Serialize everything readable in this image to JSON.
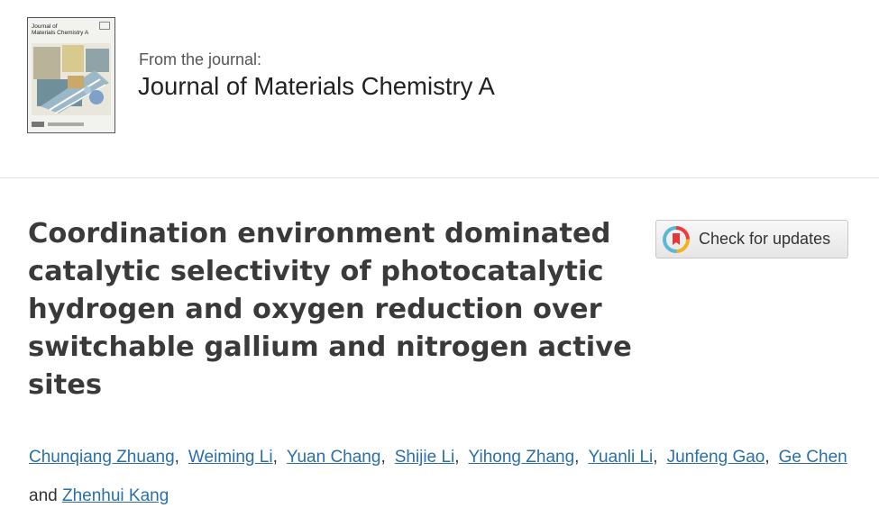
{
  "journal": {
    "cover_title": "Journal of\nMaterials Chemistry A",
    "from_label": "From the journal:",
    "name": "Journal of Materials Chemistry A"
  },
  "article": {
    "title": "Coordination environment dominated catalytic selectivity of photocatalytic hydrogen and oxygen reduction over switchable gallium and nitrogen active sites"
  },
  "check_updates": {
    "label": "Check for updates",
    "icon": "crossmark-icon"
  },
  "authors": {
    "names": [
      "Chunqiang Zhuang",
      "Weiming Li",
      "Yuan Chang",
      "Shijie Li",
      "Yihong Zhang",
      "Yuanli Li",
      "Junfeng Gao",
      "Ge Chen",
      "Zhenhui Kang"
    ],
    "separator": ",",
    "conjunction": "and"
  },
  "colors": {
    "link": "#2a6fa8",
    "title": "#3a3a3a",
    "divider": "#e3e3e3"
  }
}
